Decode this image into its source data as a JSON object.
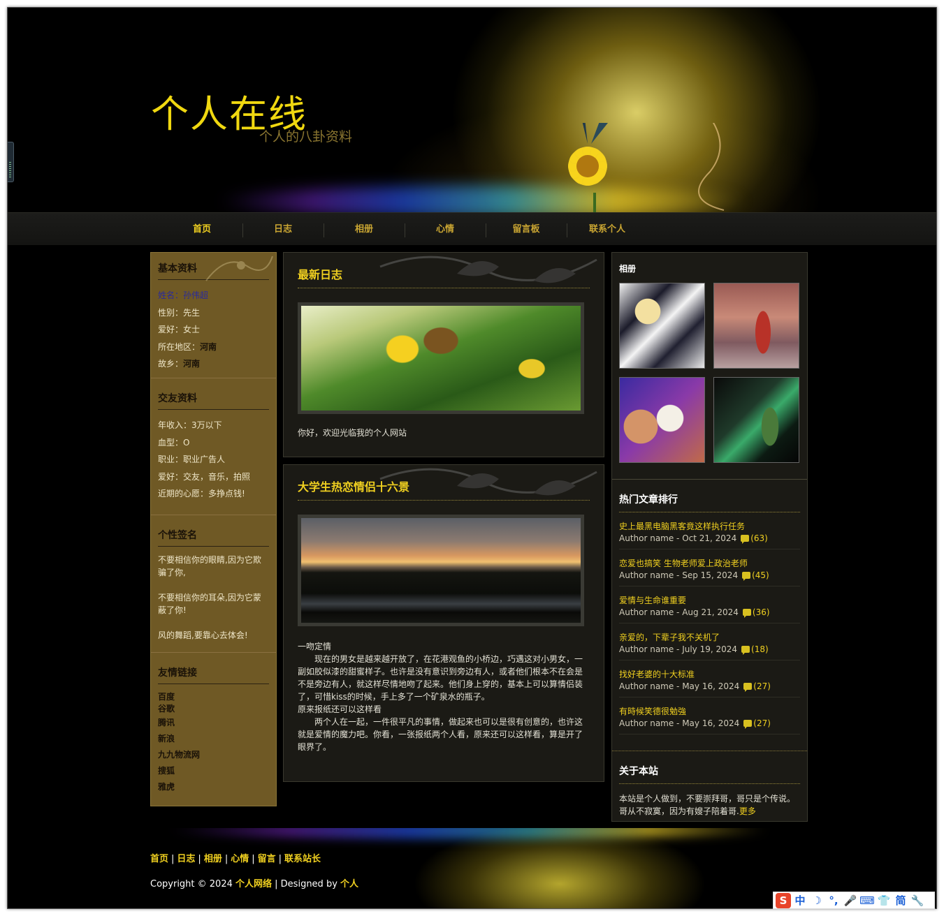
{
  "header": {
    "title": "个人在线",
    "subtitle": "个人的八卦资料"
  },
  "nav": {
    "items": [
      "首页",
      "日志",
      "相册",
      "心情",
      "留言板",
      "联系个人"
    ]
  },
  "left": {
    "basic": {
      "heading": "基本资料",
      "rows": [
        {
          "label": "姓名：",
          "value": "孙伟超"
        },
        {
          "label": "性别：",
          "value": "先生"
        },
        {
          "label": "爱好：",
          "value": "女士"
        },
        {
          "label": "所在地区：",
          "value": "河南"
        },
        {
          "label": "故乡：",
          "value": "河南"
        }
      ]
    },
    "friend": {
      "heading": "交友资料",
      "rows": [
        {
          "label": "年收入：",
          "value": "3万以下"
        },
        {
          "label": "血型：",
          "value": "O"
        },
        {
          "label": "职业：",
          "value": "职业广告人"
        },
        {
          "label": "爱好：",
          "value": "交友，音乐，拍照"
        },
        {
          "label": "近期的心愿：",
          "value": "多挣点钱!"
        }
      ]
    },
    "signature": {
      "heading": "个性签名",
      "lines": [
        "不要相信你的眼睛,因为它欺骗了你,",
        "不要相信你的耳朵,因为它蒙蔽了你!",
        "风的舞蹈,要靠心去体会!"
      ]
    },
    "links": {
      "heading": "友情链接",
      "items": [
        "百度",
        "谷歌",
        "腾讯",
        "新浪",
        "九九物流网",
        "搜狐",
        "雅虎"
      ]
    }
  },
  "posts": [
    {
      "title": "最新日志",
      "text": "你好，欢迎光临我的个人网站"
    },
    {
      "title": "大学生热恋情侣十六景",
      "lines": [
        "一吻定情",
        "　　现在的男女是越来越开放了，在花港观鱼的小桥边，巧遇这对小男女，一副如胶似漆的甜蜜样子。也许是没有意识到旁边有人，或者他们根本不在会是不是旁边有人，就这样尽情地吻了起来。他们身上穿的，基本上可以算情侣装了，可惜kiss的时候，手上多了一个矿泉水的瓶子。",
        "原来报纸还可以这样看",
        "　　两个人在一起，一件很平凡的事情，做起来也可以是很有创意的，也许这就是爱情的魔力吧。你看，一张报纸两个人看，原来还可以这样看，算是开了眼界了。"
      ]
    }
  ],
  "right": {
    "album_heading": "相册",
    "hot": {
      "heading": "热门文章排行",
      "items": [
        {
          "title": "史上最黑电脑黑客竟这样执行任务",
          "meta": "Author name - Oct 21, 2024",
          "count": "(63)"
        },
        {
          "title": "恋爱也搞笑 生物老师爱上政治老师",
          "meta": "Author name - Sep 15, 2024",
          "count": "(45)"
        },
        {
          "title": "爱情与生命谁重要",
          "meta": "Author name - Aug 21, 2024",
          "count": "(36)"
        },
        {
          "title": "亲爱的，下辈子我不关机了",
          "meta": "Author name - July 19, 2024",
          "count": "(18)"
        },
        {
          "title": "找好老婆的十大标准",
          "meta": "Author name - May 16, 2024",
          "count": "(27)"
        },
        {
          "title": "有時候笑德很勉強",
          "meta": "Author name - May 16, 2024",
          "count": "(27)"
        }
      ]
    },
    "about": {
      "heading": "关于本站",
      "text": "本站是个人做到，不要崇拜哥，哥只是个传说。哥从不寂寞，因为有嫂子陪着哥.",
      "more": "更多"
    }
  },
  "footer": {
    "links": [
      "首页",
      "日志",
      "相册",
      "心情",
      "留言",
      "联系站长"
    ],
    "copyright": "Copyright © 2024 ",
    "site": "个人网络",
    "designed": " | Designed by ",
    "designer": "个人"
  },
  "ime": {
    "logo": "S",
    "items": [
      "中",
      "☽",
      "°,",
      "🎤",
      "⌨",
      "👕",
      "简",
      "🔧"
    ]
  }
}
